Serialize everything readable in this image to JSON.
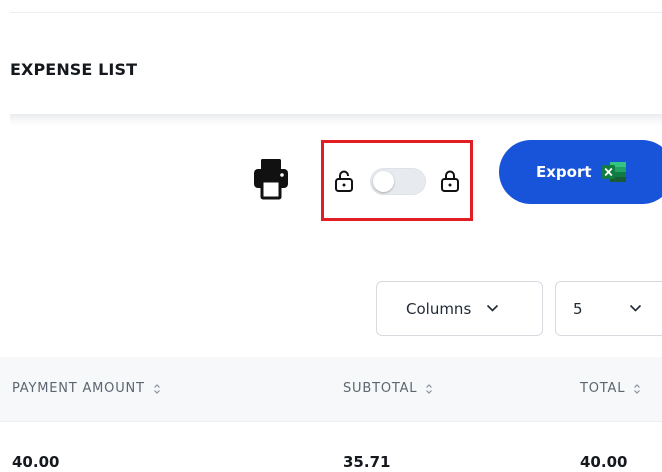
{
  "page": {
    "title": "EXPENSE LIST"
  },
  "toolbar": {
    "print_icon": "printer-icon",
    "lock_left_icon": "unlock-icon",
    "lock_right_icon": "lock-icon",
    "toggle_state": "off",
    "export_label": "Export",
    "export_icon": "excel-icon",
    "highlight_color": "#e31d24",
    "export_color": "#1754d9"
  },
  "controls": {
    "columns_label": "Columns",
    "page_size_value": "5"
  },
  "table": {
    "headers": [
      "PAYMENT AMOUNT",
      "SUBTOTAL",
      "TOTAL"
    ],
    "rows": [
      [
        "40.00",
        "35.71",
        "40.00"
      ]
    ]
  }
}
